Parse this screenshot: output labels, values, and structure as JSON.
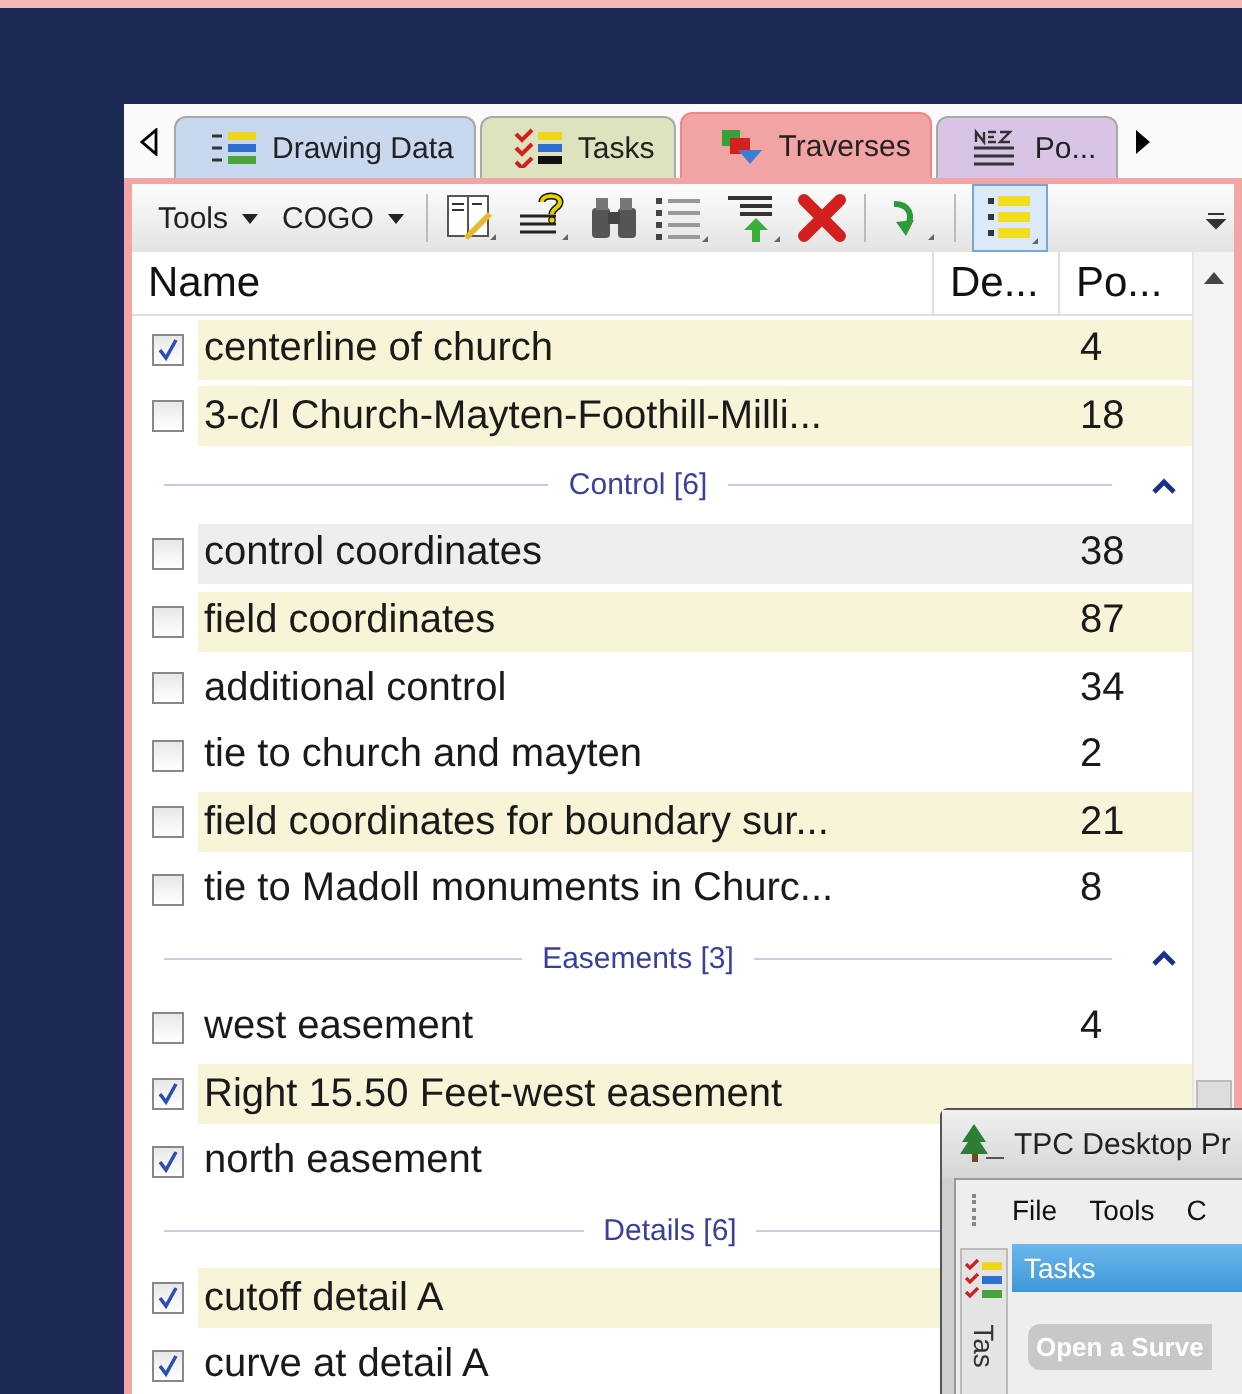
{
  "tabs": [
    {
      "label": "Drawing Data",
      "selected": false,
      "color": "#c8d8ef"
    },
    {
      "label": "Tasks",
      "selected": false,
      "color": "#dde4bd"
    },
    {
      "label": "Traverses",
      "selected": true,
      "color": "#f2a4a4"
    },
    {
      "label": "Po...",
      "selected": false,
      "color": "#d8c5e6"
    }
  ],
  "toolbar": {
    "menus": [
      {
        "label": "Tools"
      },
      {
        "label": "COGO"
      }
    ],
    "list_view_on": true
  },
  "columns": [
    "Name",
    "De...",
    "Po..."
  ],
  "sections": [
    {
      "rows": [
        {
          "name": "centerline of church",
          "points": "4",
          "checked": true,
          "highlighted": true,
          "hovered": false
        },
        {
          "name": "3-c/l Church-Mayten-Foothill-Milli...",
          "points": "18",
          "checked": false,
          "highlighted": true,
          "hovered": false
        }
      ]
    },
    {
      "header": "Control [6]",
      "expanded": true,
      "rows": [
        {
          "name": "control coordinates",
          "points": "38",
          "checked": false,
          "highlighted": false,
          "hovered": true
        },
        {
          "name": "field coordinates",
          "points": "87",
          "checked": false,
          "highlighted": true,
          "hovered": false
        },
        {
          "name": "additional control",
          "points": "34",
          "checked": false,
          "highlighted": false,
          "hovered": false
        },
        {
          "name": "tie to church and mayten",
          "points": "2",
          "checked": false,
          "highlighted": false,
          "hovered": false
        },
        {
          "name": "field coordinates for boundary sur...",
          "points": "21",
          "checked": false,
          "highlighted": true,
          "hovered": false
        },
        {
          "name": "tie to Madoll monuments in Churc...",
          "points": "8",
          "checked": false,
          "highlighted": false,
          "hovered": false
        }
      ]
    },
    {
      "header": "Easements [3]",
      "expanded": true,
      "rows": [
        {
          "name": "west easement",
          "points": "4",
          "checked": false,
          "highlighted": false,
          "hovered": false
        },
        {
          "name": "Right 15.50 Feet-west easement",
          "checked": true,
          "highlighted": true,
          "hovered": false
        },
        {
          "name": "north easement",
          "checked": true,
          "highlighted": false,
          "hovered": false
        }
      ]
    },
    {
      "header": "Details [6]",
      "rows": [
        {
          "name": "cutoff detail A",
          "checked": true,
          "highlighted": true,
          "hovered": false
        },
        {
          "name": "curve at detail A",
          "checked": true,
          "highlighted": false,
          "hovered": false
        }
      ]
    }
  ],
  "popup_window": {
    "title": "TPC Desktop Pr",
    "menu": [
      "File",
      "Tools",
      "C"
    ],
    "side_tab": "Tas",
    "panel_title": "Tasks",
    "button": "Open a Surve"
  }
}
